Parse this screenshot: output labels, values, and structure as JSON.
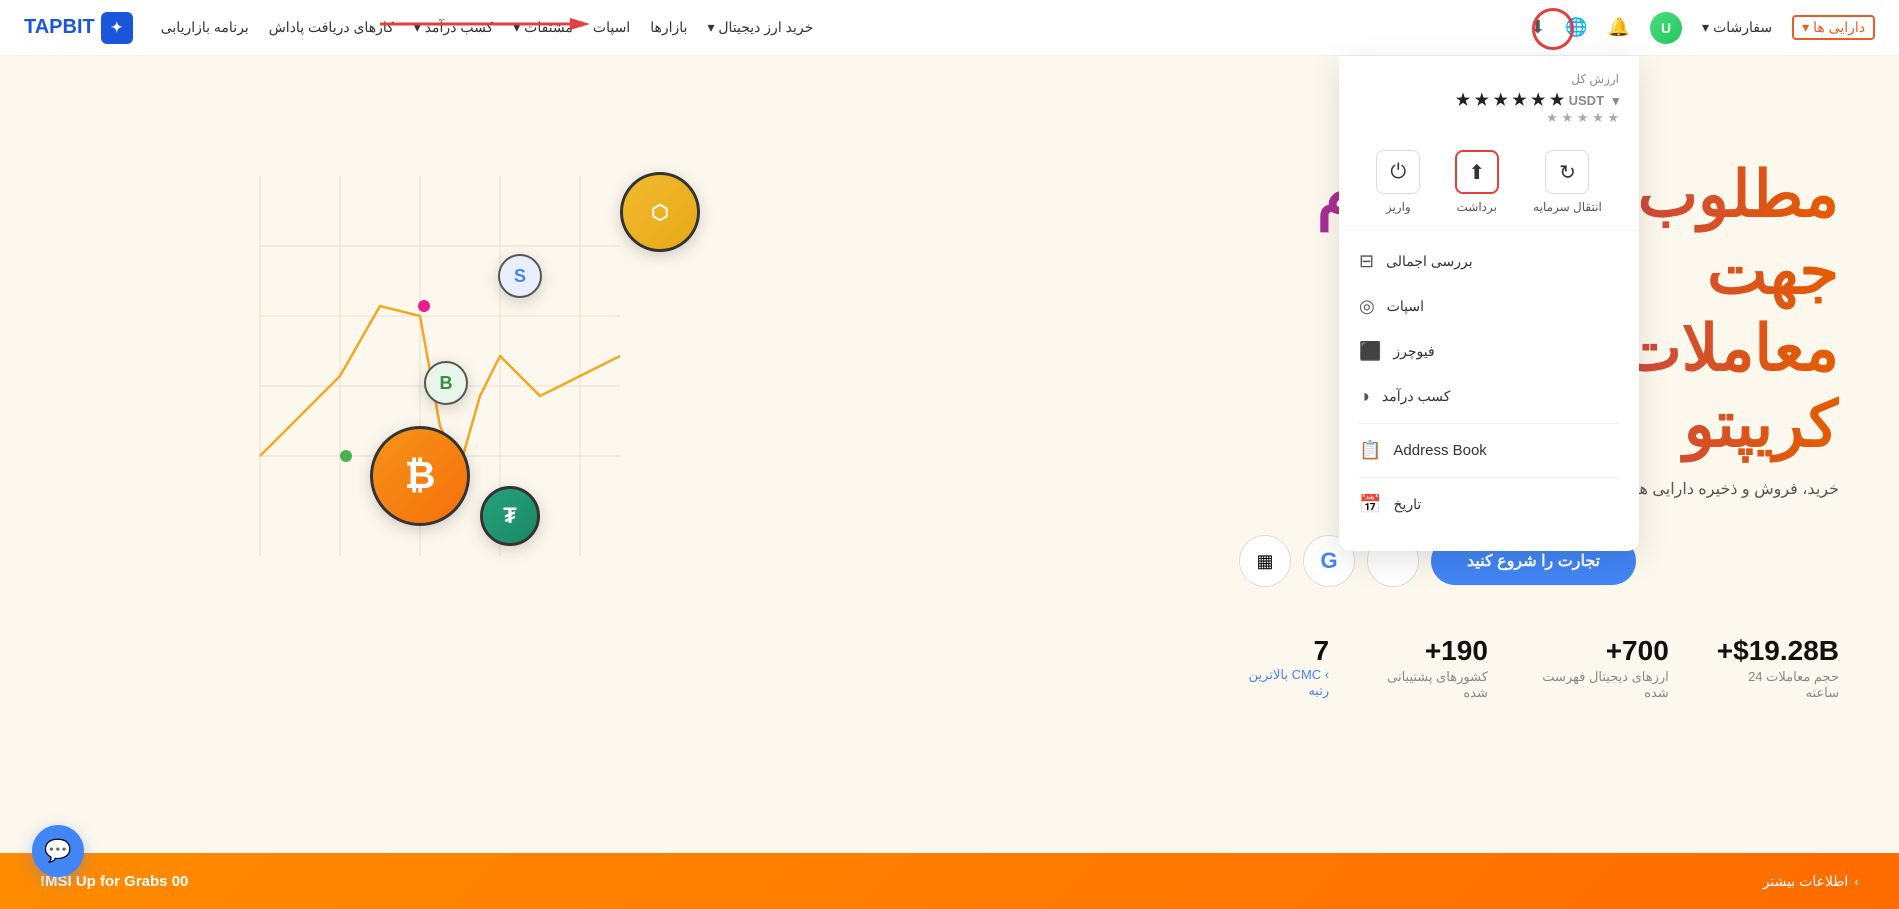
{
  "brand": {
    "name": "TAPBIT",
    "logo_text": "✦"
  },
  "nav": {
    "right_menu": [
      {
        "label": "خرید ارز دیجیتال",
        "has_dropdown": true
      },
      {
        "label": "بازارها"
      },
      {
        "label": "اسپات"
      },
      {
        "label": "مشتقات",
        "has_dropdown": true
      },
      {
        "label": "کسب درآمد",
        "has_dropdown": true
      },
      {
        "label": "کارهای دریافت پاداش"
      },
      {
        "label": "برنامه بازاریابی"
      }
    ],
    "icons": {
      "download": "⬇",
      "globe": "🌐",
      "bell": "🔔"
    },
    "user_menu": {
      "daraii_label": "دارایی ها",
      "safareshat_label": "سفارشات"
    }
  },
  "dropdown": {
    "header_label": "ارزش کل",
    "balance_currency": "USDT",
    "balance_stars": "★ ★ ★ ★ ★ ★",
    "balance_sub": "★ ★ ★ ★ ★",
    "actions": [
      {
        "label": "واریز",
        "icon": "⏻"
      },
      {
        "label": "برداشت",
        "icon": "⬆",
        "active": true
      },
      {
        "label": "انتقال سرمایه",
        "icon": "↻"
      }
    ],
    "menu_items": [
      {
        "label": "بررسی اجمالی",
        "icon": "⊟"
      },
      {
        "label": "اسپات",
        "icon": "◎"
      },
      {
        "label": "فیوچرز",
        "icon": "⬛"
      },
      {
        "label": "کسب درآمد",
        "icon": "◑"
      }
    ],
    "address_book_label": "Address Book",
    "address_book_icon": "📋",
    "history_label": "تاریخ",
    "history_icon": "📅"
  },
  "hero": {
    "title_line1": "مطلوب ترین پلتفرم جهت",
    "title_line2": "معاملات مشتقات کریپتو",
    "subtitle": "خرید، فروش و ذخیره دارایی های دیجیتال در صرافی پیشرو جهان.",
    "cta_label": "تجارت را شروع کنید",
    "btn_qr": "▦",
    "btn_google": "G",
    "btn_apple": ""
  },
  "stats": [
    {
      "value": "+$19.28B",
      "label": "حجم معاملات 24 ساعته"
    },
    {
      "value": "+700",
      "label": "ارزهای دیجیتال فهرست شده"
    },
    {
      "value": "+190",
      "label": "کشورهای پشتیبانی شده"
    },
    {
      "value": "7",
      "label": "▸ CMC بالاترین رتبه",
      "is_cmc": true
    }
  ],
  "banner": {
    "text": "00 MSI Up for Grabs!",
    "more_label": "اطلاعات بیشتر",
    "more_icon": "›"
  },
  "coins": [
    {
      "symbol": "⬡",
      "label": "BNB"
    },
    {
      "symbol": "S",
      "label": "S"
    },
    {
      "symbol": "₿",
      "label": "BTC"
    },
    {
      "symbol": "₮",
      "label": "USDT"
    },
    {
      "symbol": "B",
      "label": "B"
    }
  ]
}
